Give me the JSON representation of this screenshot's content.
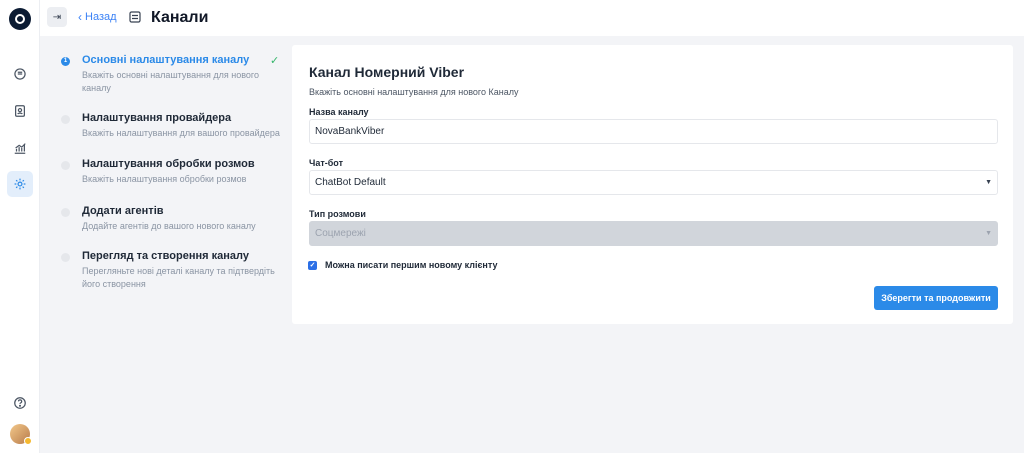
{
  "header": {
    "back_label": "Назад",
    "title": "Канали"
  },
  "steps": [
    {
      "title": "Основні налаштування каналу",
      "desc": "Вкажіть основні налаштування для нового каналу",
      "number": "1",
      "state": "active"
    },
    {
      "title": "Налаштування провайдера",
      "desc": "Вкажіть налаштування для вашого провайдера",
      "state": "pending"
    },
    {
      "title": "Налаштування обробки розмов",
      "desc": "Вкажіть налаштування обробки розмов",
      "state": "pending"
    },
    {
      "title": "Додати агентів",
      "desc": "Додайте агентів до вашого нового каналу",
      "state": "pending"
    },
    {
      "title": "Перегляд та створення каналу",
      "desc": "Перегляньте нові деталі каналу та підтвердіть його створення",
      "state": "pending"
    }
  ],
  "form": {
    "title": "Канал Номерний Viber",
    "subtitle": "Вкажіть основні налаштування для нового Каналу",
    "name_label": "Назва каналу",
    "name_value": "NovaBankViber",
    "chatbot_label": "Чат-бот",
    "chatbot_value": "ChatBot Default",
    "type_label": "Тип розмови",
    "type_value": "Соцмережі",
    "checkbox_label": "Можна писати першим новому клієнту",
    "checkbox_checked": true,
    "submit_label": "Зберегти та продовжити"
  },
  "rail": {
    "icons": [
      "logo-icon",
      "chat-icon",
      "contacts-icon",
      "analytics-icon",
      "settings-icon",
      "help-icon"
    ],
    "active": "settings-icon"
  },
  "colors": {
    "accent": "#2b8ae8",
    "check": "#35b66b",
    "background": "#f3f4f7"
  }
}
